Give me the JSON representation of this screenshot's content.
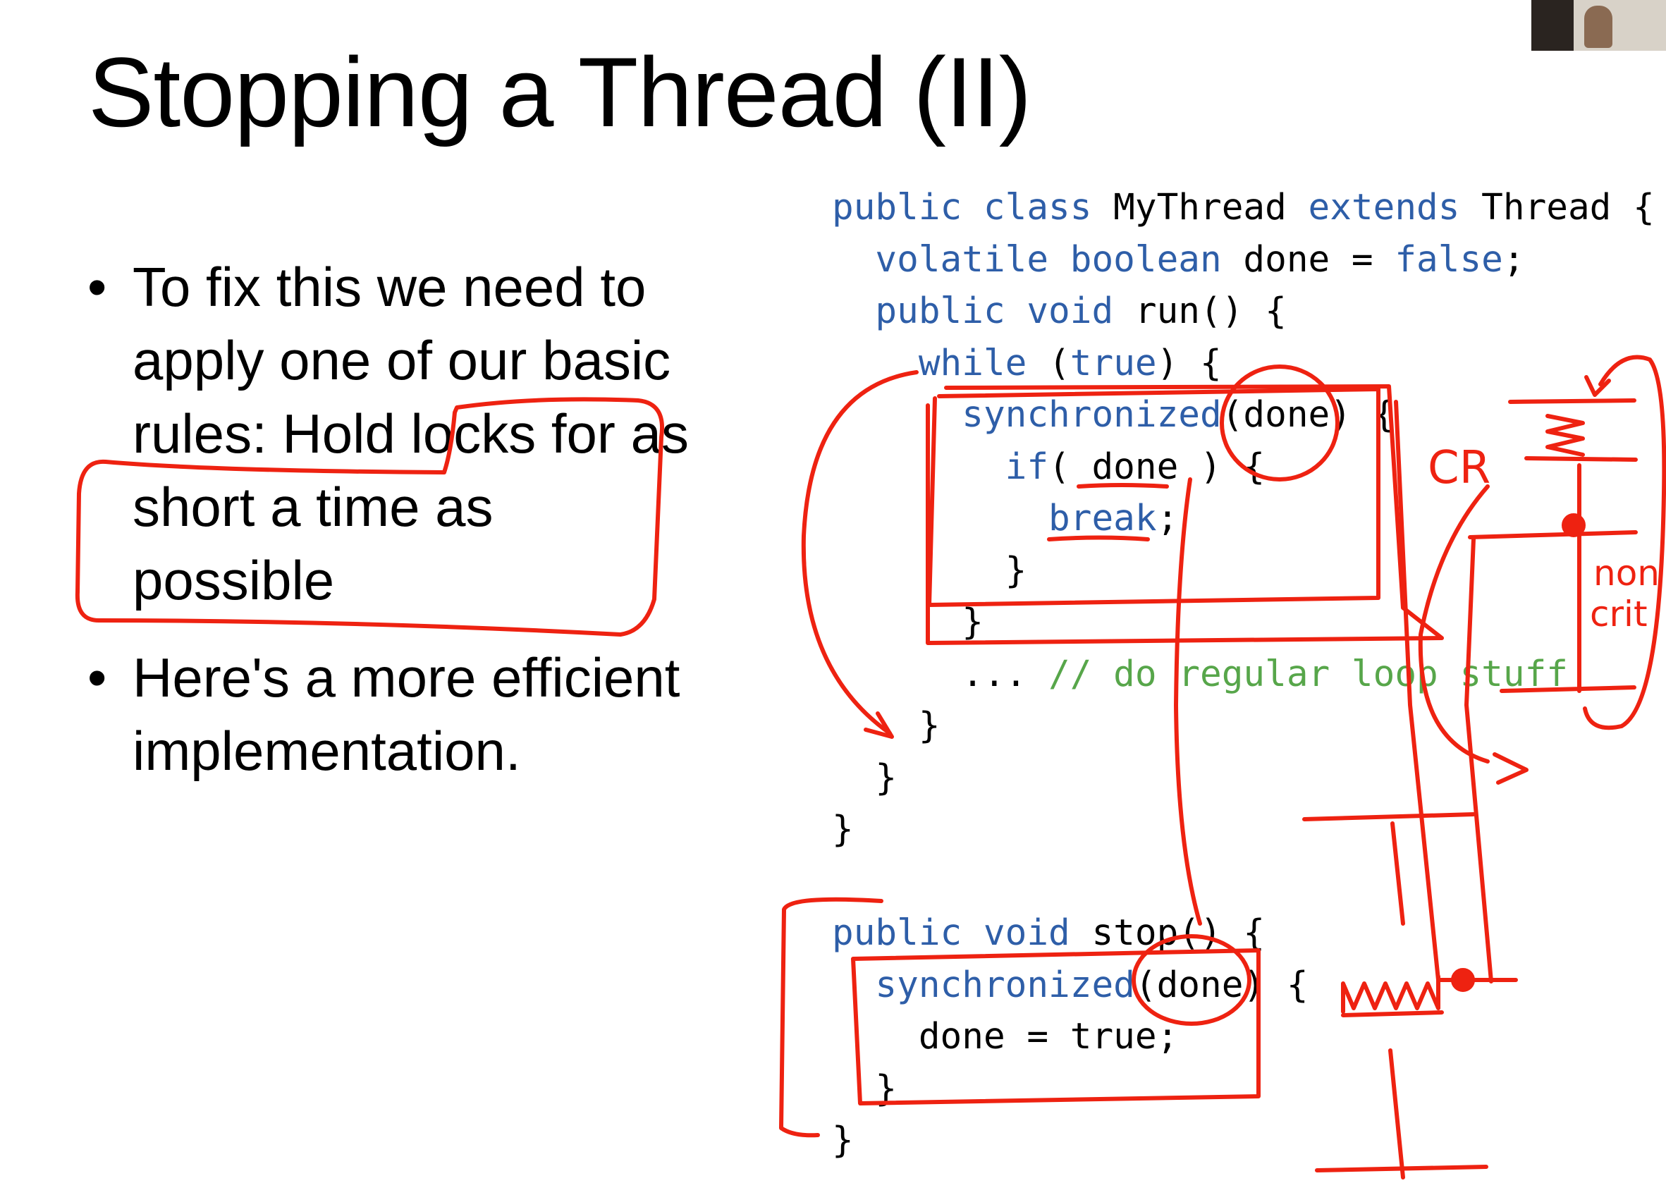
{
  "slide": {
    "title": "Stopping a Thread (II)",
    "bullets": [
      {
        "marker": "•",
        "text": "To fix this we need to apply one of our basic rules: Hold locks for as short a time as possible"
      },
      {
        "marker": "•",
        "text": "Here's a more efficient implementation."
      }
    ]
  },
  "code": {
    "line1": {
      "kw1": "public class",
      "t1": " MyThread ",
      "kw2": "extends",
      "t2": " Thread {"
    },
    "line2": {
      "indent": "  ",
      "kw1": "volatile boolean",
      "t1": " done = ",
      "kw2": "false",
      "t2": ";"
    },
    "line3": {
      "indent": "  ",
      "kw1": "public void",
      "t1": " run() {"
    },
    "line4": {
      "indent": "    ",
      "kw1": "while",
      "t1": " (",
      "kw2": "true",
      "t2": ") {"
    },
    "line5": {
      "indent": "      ",
      "kw1": "synchronized",
      "t1": "(done) {"
    },
    "line6": {
      "indent": "        ",
      "kw1": "if",
      "t1": "( done ) {"
    },
    "line7": {
      "indent": "          ",
      "kw1": "break",
      "t1": ";"
    },
    "line8": {
      "indent": "        ",
      "t1": "}"
    },
    "line9": {
      "indent": "      ",
      "t1": "}"
    },
    "line10": {
      "indent": "      ",
      "t1": "... ",
      "cm": "// do regular loop stuff"
    },
    "line11": {
      "indent": "    ",
      "t1": "}"
    },
    "line12": {
      "indent": "  ",
      "t1": "}"
    },
    "line13": {
      "t1": "}"
    },
    "line14": {
      "t1": " "
    },
    "line15": {
      "kw1": "public void",
      "t1": " stop() {"
    },
    "line16": {
      "indent": "  ",
      "kw1": "synchronized",
      "t1": "(done) {"
    },
    "line17": {
      "indent": "    ",
      "t1": "done = true;"
    },
    "line18": {
      "indent": "  ",
      "t1": "}"
    },
    "line19": {
      "t1": "}"
    }
  },
  "annotations": {
    "cr_label": "CR",
    "non_label": "non",
    "crit_label": "crit",
    "ink_color": "#ee2211"
  },
  "colors": {
    "keyword": "#2e5ea8",
    "comment": "#57a64a",
    "text": "#000000",
    "background": "#ffffff"
  }
}
